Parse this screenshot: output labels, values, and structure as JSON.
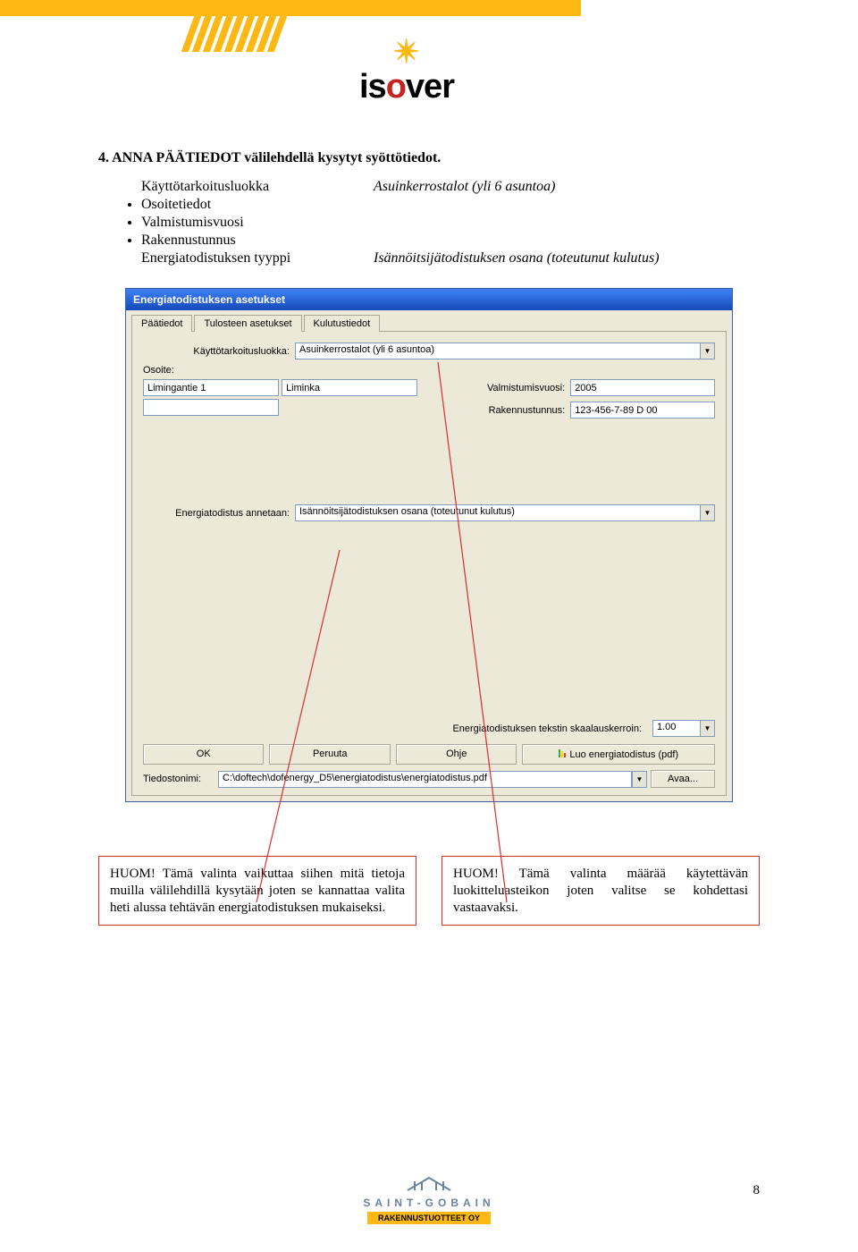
{
  "page": {
    "number": "8"
  },
  "logo": {
    "text_iso": "is",
    "text_o": "o",
    "text_ver": "ver"
  },
  "heading": "4. ANNA PÄÄTIEDOT välilehdellä kysytyt syöttötiedot.",
  "bullets": {
    "a": {
      "left": "Käyttötarkoitusluokka",
      "right": "Asuinkerrostalot (yli 6 asuntoa)"
    },
    "b": "Osoitetiedot",
    "c": "Valmistumisvuosi",
    "d": "Rakennustunnus",
    "e": {
      "left": "Energiatodistuksen tyyppi",
      "right": "Isännöitsijätodistuksen osana (toteutunut kulutus)"
    }
  },
  "dialog": {
    "title": "Energiatodistuksen asetukset",
    "tabs": [
      "Päätiedot",
      "Tulosteen asetukset",
      "Kulutustiedot"
    ],
    "purpose_label": "Käyttötarkoitusluokka:",
    "purpose_value": "Asuinkerrostalot (yli 6 asuntoa)",
    "address_label": "Osoite:",
    "address_lines": [
      "Limingantie 1",
      "Liminka",
      ""
    ],
    "year_label": "Valmistumisvuosi:",
    "year_value": "2005",
    "buildcode_label": "Rakennustunnus:",
    "buildcode_value": "123-456-7-89 D 00",
    "issue_label": "Energiatodistus annetaan:",
    "issue_value": "Isännöitsijätodistuksen osana (toteutunut kulutus)",
    "scale_label": "Energiatodistuksen tekstin skaalauskerroin:",
    "scale_value": "1.00",
    "buttons": {
      "ok": "OK",
      "cancel": "Peruuta",
      "help": "Ohje",
      "create": "Luo energiatodistus (pdf)"
    },
    "file_label": "Tiedostonimi:",
    "file_value": "C:\\doftech\\dofenergy_D5\\energiatodistus\\energiatodistus.pdf",
    "open_btn": "Avaa..."
  },
  "notes": {
    "left": "HUOM! Tämä valinta vaikuttaa siihen mitä tietoja muilla välilehdillä kysytään joten se kannattaa valita heti alussa tehtävän energiatodistuksen mukaiseksi.",
    "right": "HUOM! Tämä valinta määrää käytettävän luokitteluasteikon joten valitse se kohdettasi vastaavaksi."
  },
  "footer": {
    "line1": "SAINT-GOBAIN",
    "line2": "RAKENNUSTUOTTEET OY"
  }
}
